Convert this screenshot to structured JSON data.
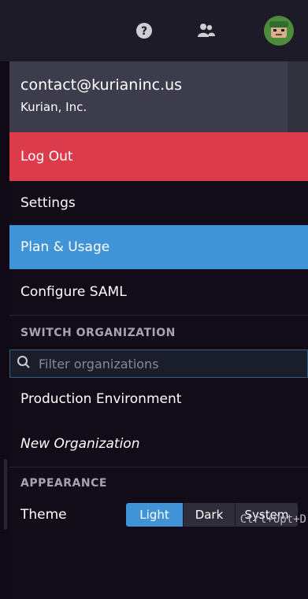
{
  "topbar": {
    "icons": [
      "help-icon",
      "users-icon",
      "avatar"
    ],
    "avatar_colors": {
      "background": "#4c8a3c",
      "face": "#d9b08c"
    }
  },
  "account": {
    "email": "contact@kurianinc.us",
    "organization": "Kurian, Inc."
  },
  "menu": {
    "logout_label": "Log Out",
    "settings_label": "Settings",
    "plan_label": "Plan & Usage",
    "saml_label": "Configure SAML"
  },
  "switch_org": {
    "header": "SWITCH ORGANIZATION",
    "filter_placeholder": "Filter organizations",
    "filter_value": "",
    "organizations": [
      "Production Environment"
    ],
    "new_org_label": "New Organization"
  },
  "appearance": {
    "header": "APPEARANCE",
    "theme_label": "Theme",
    "options": [
      "Light",
      "Dark",
      "System"
    ],
    "selected": "Light",
    "shortcut": "Ctrl+Opt+D"
  },
  "colors": {
    "logout": "#dc3b4c",
    "plan_highlight": "#3f93d6",
    "account_bg": "#3d3c4c",
    "menu_bg": "#120c18"
  }
}
